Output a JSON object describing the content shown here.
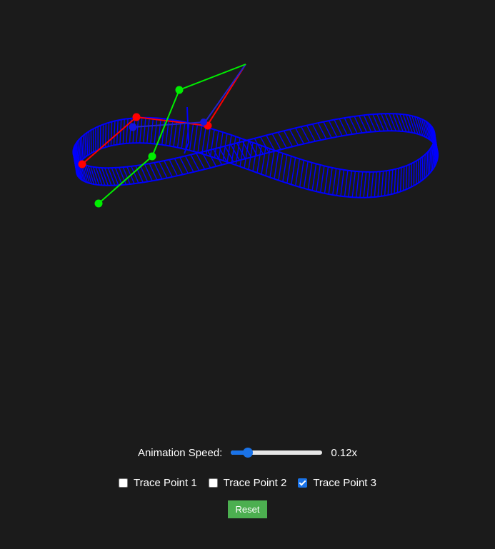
{
  "controls": {
    "speed_label": "Animation Speed:",
    "speed_value": "0.12x",
    "speed_fraction": 0.15,
    "checkboxes": [
      {
        "label": "Trace Point 1",
        "checked": false
      },
      {
        "label": "Trace Point 2",
        "checked": false
      },
      {
        "label": "Trace Point 3",
        "checked": true
      }
    ],
    "reset_label": "Reset"
  },
  "colors": {
    "background": "#1b1b1b",
    "trace": "#0000ff",
    "red_arm": "#ff0000",
    "green_arm": "#00ff00",
    "slider_accent": "#1a73e8",
    "reset_button": "#4caf50"
  }
}
